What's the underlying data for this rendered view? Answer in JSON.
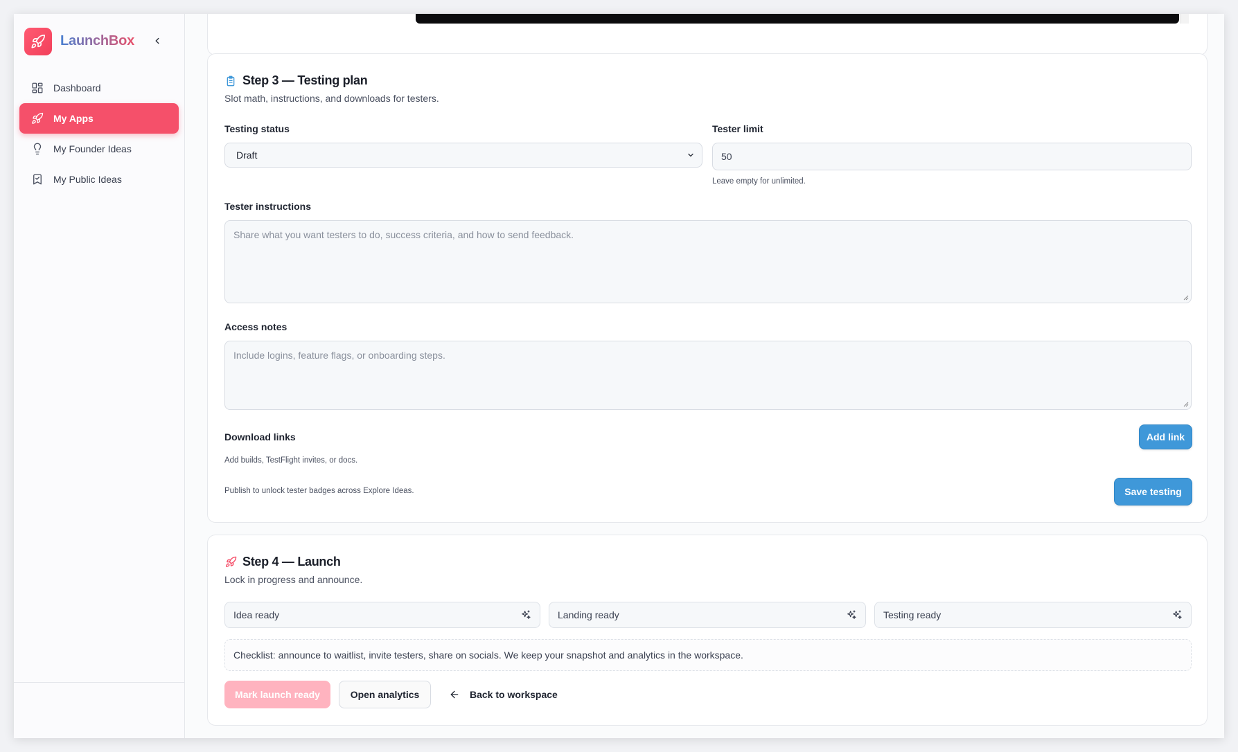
{
  "brand": {
    "name": "LaunchBox"
  },
  "sidebar": {
    "items": [
      {
        "label": "Dashboard",
        "icon": "grid-icon"
      },
      {
        "label": "My Apps",
        "icon": "rocket-icon",
        "active": true
      },
      {
        "label": "My Founder Ideas",
        "icon": "lightbulb-icon"
      },
      {
        "label": "My Public Ideas",
        "icon": "bookmark-check-icon"
      }
    ]
  },
  "step3": {
    "title": "Step 3 — Testing plan",
    "subtitle": "Slot math, instructions, and downloads for testers.",
    "testing_status": {
      "label": "Testing status",
      "value": "Draft"
    },
    "tester_limit": {
      "label": "Tester limit",
      "value": "50",
      "hint": "Leave empty for unlimited."
    },
    "tester_instructions": {
      "label": "Tester instructions",
      "placeholder": "Share what you want testers to do, success criteria, and how to send feedback."
    },
    "access_notes": {
      "label": "Access notes",
      "placeholder": "Include logins, feature flags, or onboarding steps."
    },
    "download_links": {
      "label": "Download links",
      "hint": "Add builds, TestFlight invites, or docs.",
      "add_label": "Add link"
    },
    "publish_hint": "Publish to unlock tester badges across Explore Ideas.",
    "save_label": "Save testing"
  },
  "step4": {
    "title": "Step 4 — Launch",
    "subtitle": "Lock in progress and announce.",
    "pills": [
      "Idea ready",
      "Landing ready",
      "Testing ready"
    ],
    "checklist": "Checklist: announce to waitlist, invite testers, share on socials. We keep your snapshot and analytics in the workspace.",
    "mark_ready_label": "Mark launch ready",
    "open_analytics_label": "Open analytics",
    "back_label": "Back to workspace"
  },
  "colors": {
    "accent": "#f5506a",
    "primary_blue": "#3f98d9",
    "disabled_pink": "#ffb3bf"
  }
}
